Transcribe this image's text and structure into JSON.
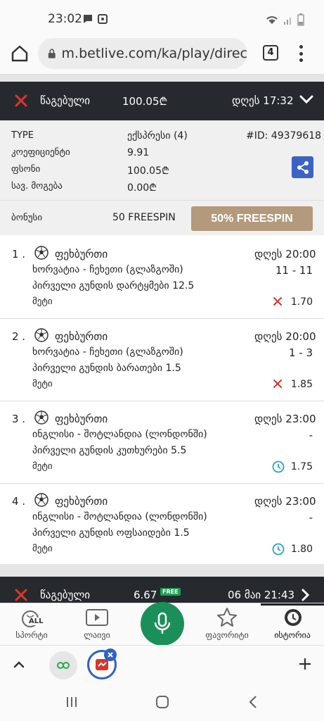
{
  "status_bar": {
    "time": "23:02"
  },
  "browser": {
    "url": "m.betlive.com/ka/play/direc",
    "tab_count": "4"
  },
  "ticket": {
    "status": "წაგებული",
    "amount": "100.05₾",
    "date": "დღეს 17:32",
    "type_label": "TYPE",
    "type_value": "ექსპრესი (4)",
    "id": "#ID: 49379618",
    "coef_label": "კოეფიციენტი",
    "coef_value": "9.91",
    "stake_label": "ფსონი",
    "stake_value": "100.05₾",
    "potwin_label": "სავ. მოგება",
    "potwin_value": "0.00₾",
    "bonus_label": "ბონუსი",
    "bonus_value": "50 FREESPIN",
    "bonus_button": "50% FREESPIN"
  },
  "events": [
    {
      "num": "1 .",
      "sport": "ფეხბურთი",
      "date": "დღეს 20:00",
      "match": "ხორვატია - ჩეხეთი (გლაზგოში)",
      "score": "11 - 11",
      "market": "პირველი გუნდის დარტყმები 12.5",
      "pick": "მეტი",
      "status": "lost",
      "odds": "1.70"
    },
    {
      "num": "2 .",
      "sport": "ფეხბურთი",
      "date": "დღეს 20:00",
      "match": "ხორვატია - ჩეხეთი (გლაზგოში)",
      "score": "1 - 3",
      "market": "პირველი გუნდის ბარათები 1.5",
      "pick": "მეტი",
      "status": "lost",
      "odds": "1.85"
    },
    {
      "num": "3 .",
      "sport": "ფეხბურთი",
      "date": "დღეს 23:00",
      "match": "ინგლისი - შოტლანდია (ლონდონში)",
      "score": "-",
      "market": "პირველი გუნდის კუთხურები 5.5",
      "pick": "მეტი",
      "status": "pending",
      "odds": "1.75"
    },
    {
      "num": "4 .",
      "sport": "ფეხბურთი",
      "date": "დღეს 23:00",
      "match": "ინგლისი - შოტლანდია (ლონდონში)",
      "score": "-",
      "market": "პირველი გუნდის ოფსაიდები 1.5",
      "pick": "მეტი",
      "status": "pending",
      "odds": "1.80"
    }
  ],
  "ticket2": {
    "status": "წაგებული",
    "amount": "6.67",
    "free_badge": "FREE",
    "date": "06 მაი 21:43"
  },
  "nav": {
    "sports": "სპორტი",
    "sports_badge": "ALL",
    "live": "ლაივი",
    "favorites": "ფავორიტი",
    "history": "ისტორია"
  },
  "colors": {
    "header_bg": "#262a2f",
    "lost": "#d9342b",
    "pending": "#29a3c7",
    "bonus_btn": "#b39a7c",
    "share": "#3b63c4",
    "mic": "#1a8f5a"
  }
}
